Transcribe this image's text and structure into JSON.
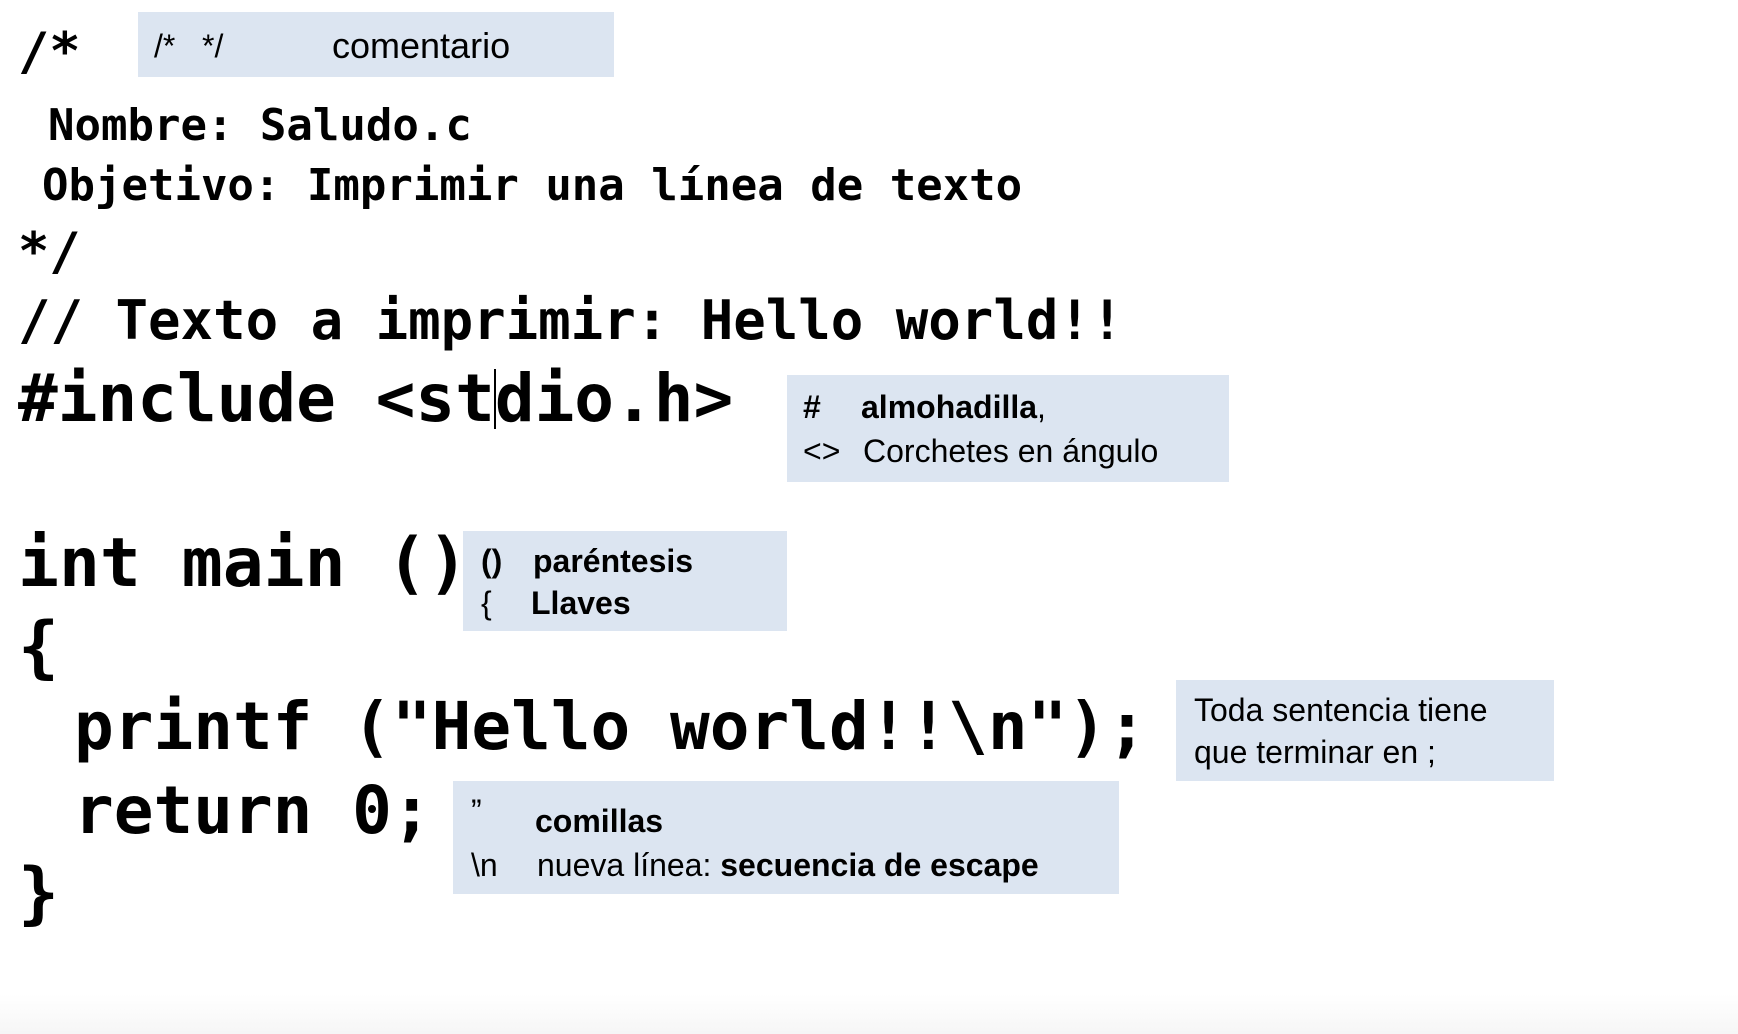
{
  "code": {
    "comment_open": "/*",
    "nombre_line": "Nombre: Saludo.c",
    "objetivo_line": "Objetivo: Imprimir una línea de texto",
    "comment_close": "*/",
    "line_comment": "// Texto a imprimir: Hello world!!",
    "include_before_cursor": "#include <st",
    "include_after_cursor": "dio.h>",
    "main_signature": "int main ()",
    "open_brace": "{",
    "printf_line": "printf (\"Hello world!!\\n\");",
    "return_line": "return 0;",
    "close_brace": "}"
  },
  "notes": {
    "comment": {
      "symbols": "/*   */",
      "label": "comentario"
    },
    "include": {
      "hash_symbol": "#",
      "hash_label": "almohadilla",
      "hash_comma": ",",
      "angle_symbol": "<>",
      "angle_label": "Corchetes en ángulo"
    },
    "braces": {
      "paren_symbol": "()",
      "paren_label": "paréntesis",
      "brace_symbol": "{",
      "brace_label": "Llaves"
    },
    "statement": {
      "line1": "Toda sentencia tiene",
      "line2": "que terminar en ;"
    },
    "quotes": {
      "quote_symbol": "”",
      "quote_label": "comillas",
      "newline_symbol": "\\n",
      "newline_prefix": "nueva línea: ",
      "newline_bold": "secuencia de escape"
    }
  }
}
